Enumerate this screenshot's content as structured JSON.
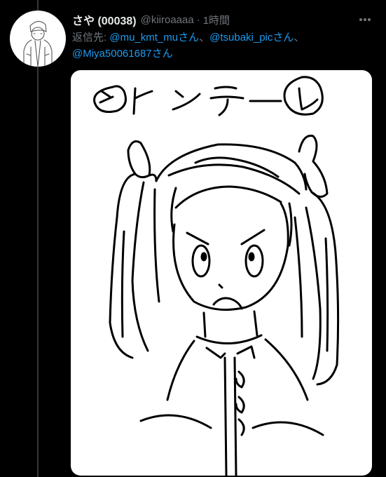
{
  "tweet": {
    "display_name": "さや (00038)",
    "handle": "@kiiroaaaa",
    "separator": "·",
    "time": "1時間",
    "reply_prefix": "返信先: ",
    "mentions": [
      {
        "text": "@mu_kmt_muさん"
      },
      {
        "text": "@tsubaki_picさん"
      },
      {
        "text": "@Miya50061687さん"
      }
    ],
    "mention_separator": "、",
    "more_icon": "more-horizontal-icon",
    "media": {
      "kind": "image",
      "drawn_text": "ツインテール"
    }
  },
  "colors": {
    "background": "#000000",
    "name": "#e7e9ea",
    "muted": "#71767b",
    "link": "#1d9bf0",
    "thread_line": "#333639"
  }
}
